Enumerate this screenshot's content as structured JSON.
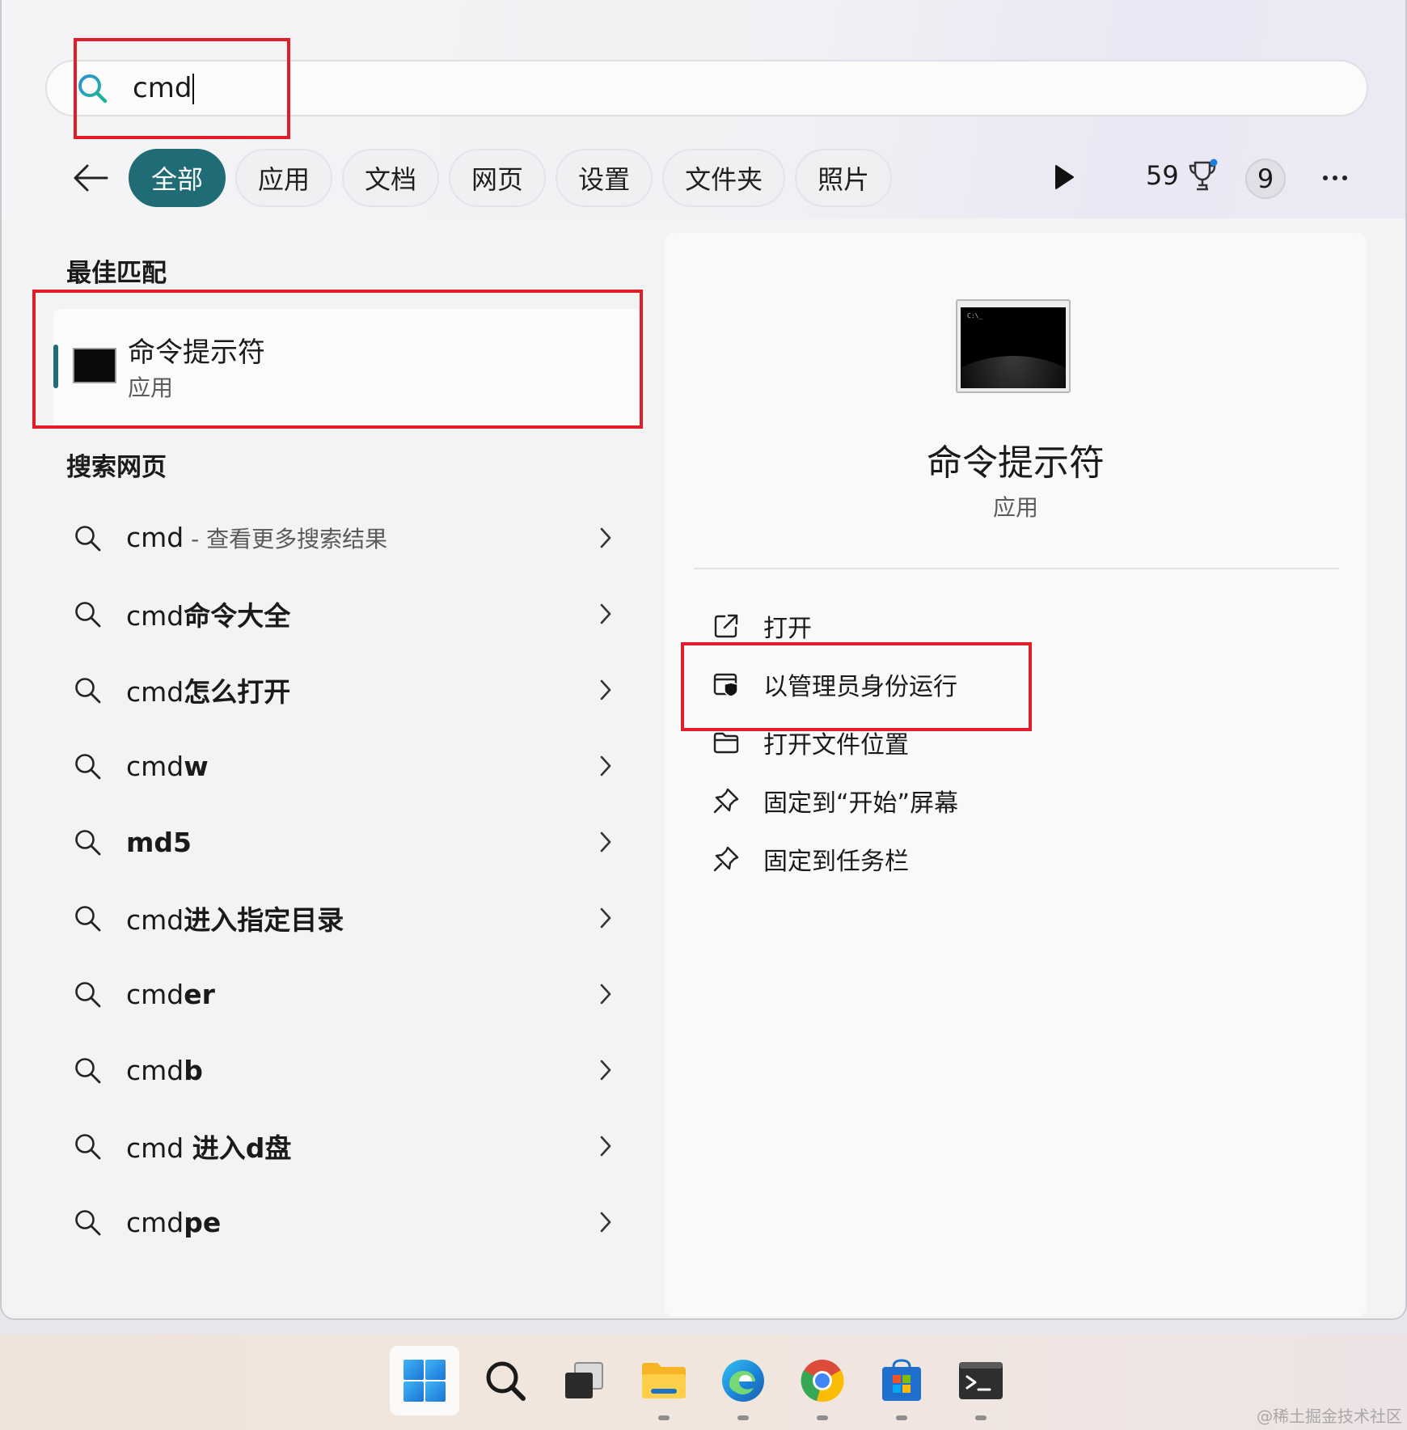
{
  "search": {
    "value": "cmd"
  },
  "filters": {
    "chips": [
      "全部",
      "应用",
      "文档",
      "网页",
      "设置",
      "文件夹",
      "照片"
    ],
    "points": "59",
    "badge": "9"
  },
  "best_match": {
    "title": "最佳匹配",
    "name": "命令提示符",
    "type": "应用"
  },
  "web_search": {
    "title": "搜索网页",
    "items": [
      {
        "prefix": "cmd",
        "bold": "",
        "sub": " - 查看更多搜索结果"
      },
      {
        "prefix": "cmd",
        "bold": "命令大全",
        "sub": ""
      },
      {
        "prefix": "cmd",
        "bold": "怎么打开",
        "sub": ""
      },
      {
        "prefix": "cmd",
        "bold": "w",
        "sub": ""
      },
      {
        "prefix": "",
        "bold": "md5",
        "sub": ""
      },
      {
        "prefix": "cmd",
        "bold": "进入指定目录",
        "sub": ""
      },
      {
        "prefix": "cmd",
        "bold": "er",
        "sub": ""
      },
      {
        "prefix": "cmd",
        "bold": "b",
        "sub": ""
      },
      {
        "prefix": "cmd ",
        "bold": "进入d盘",
        "sub": ""
      },
      {
        "prefix": "cmd",
        "bold": "pe",
        "sub": ""
      }
    ]
  },
  "detail": {
    "thumb_prompt": "C:\\_",
    "name": "命令提示符",
    "type": "应用",
    "actions": [
      {
        "label": "打开",
        "icon": "open-external-icon"
      },
      {
        "label": "以管理员身份运行",
        "icon": "admin-shield-icon"
      },
      {
        "label": "打开文件位置",
        "icon": "folder-icon"
      },
      {
        "label": "固定到“开始”屏幕",
        "icon": "pin-icon"
      },
      {
        "label": "固定到任务栏",
        "icon": "pin-icon"
      }
    ]
  },
  "taskbar": {
    "apps": [
      "start-icon",
      "search-icon",
      "task-view-icon",
      "file-explorer-icon",
      "edge-icon",
      "chrome-icon",
      "store-icon",
      "terminal-icon"
    ]
  },
  "watermark": "@稀土掘金技术社区",
  "colors": {
    "accent": "#1f6c76",
    "annotation": "#e11d2a"
  }
}
